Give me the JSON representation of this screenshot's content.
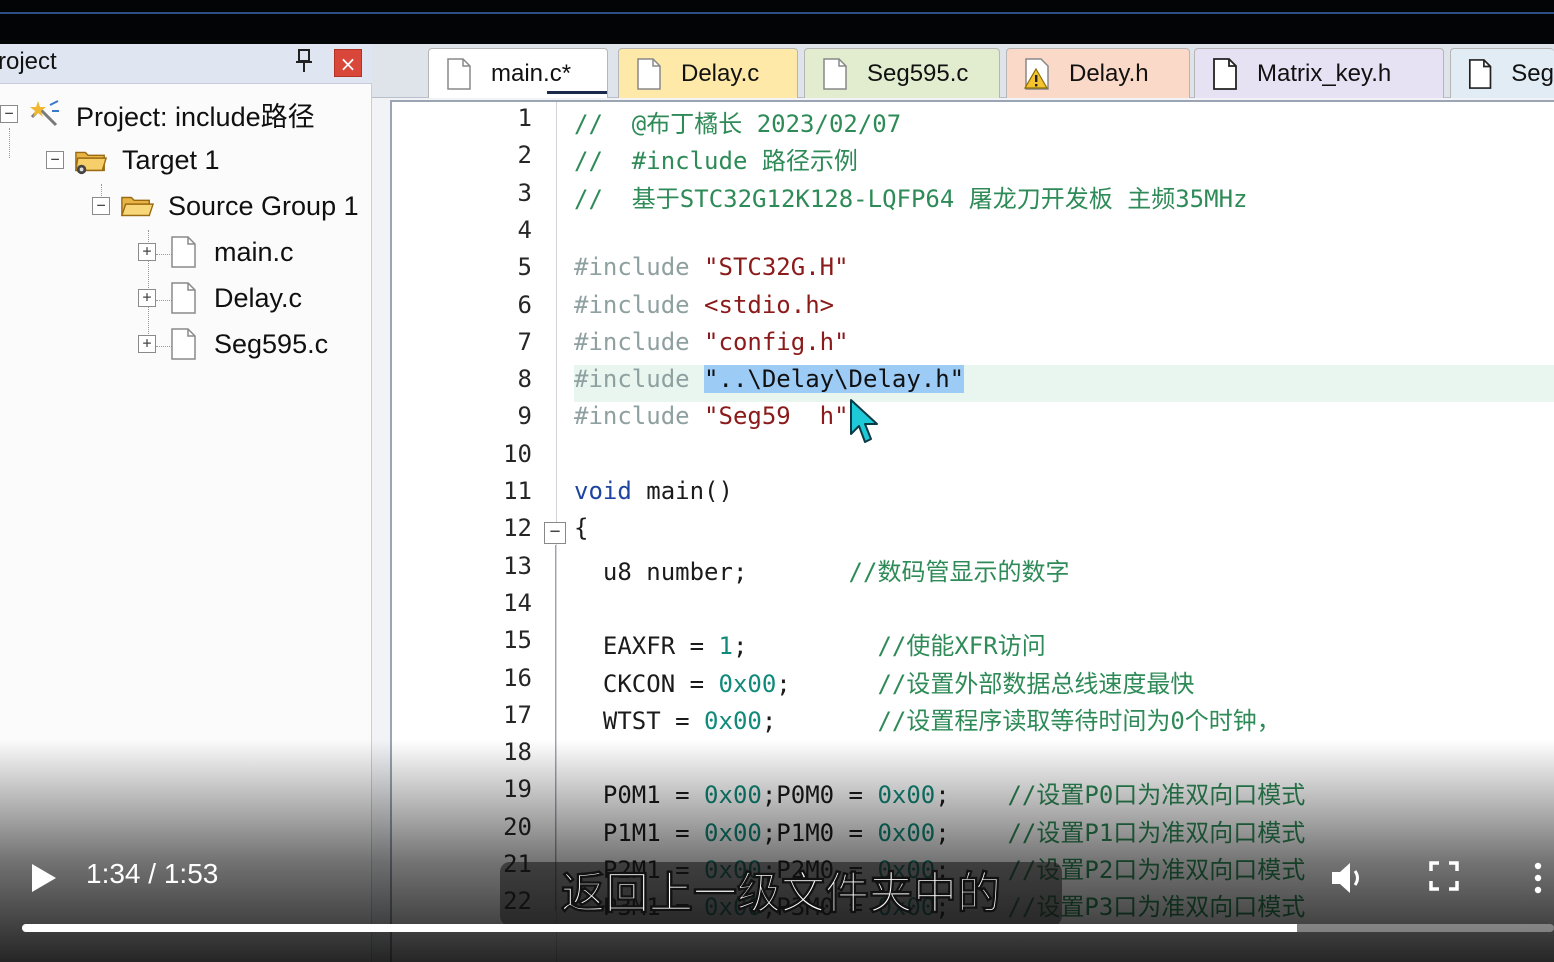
{
  "project_panel": {
    "title": "roject",
    "pin_glyph": "📌",
    "close_glyph": "×",
    "tree": {
      "project_label": "Project: include路径",
      "target_label": "Target 1",
      "group_label": "Source Group 1",
      "files": [
        "main.c",
        "Delay.c",
        "Seg595.c"
      ]
    }
  },
  "editor": {
    "tabs": [
      "main.c*",
      "Delay.c",
      "Seg595.c",
      "Delay.h",
      "Matrix_key.h",
      "Seg"
    ],
    "active_tab": "main.c*",
    "lines": [
      {
        "n": "1",
        "t": [
          [
            "cm",
            "//  @布丁橘长 2023/02/07"
          ]
        ]
      },
      {
        "n": "2",
        "t": [
          [
            "cm",
            "//  #include 路径示例"
          ]
        ]
      },
      {
        "n": "3",
        "t": [
          [
            "cm",
            "//  基于STC32G12K128-LQFP64 屠龙刀开发板 主频35MHz"
          ]
        ]
      },
      {
        "n": "4",
        "t": []
      },
      {
        "n": "5",
        "t": [
          [
            "pp",
            "#include "
          ],
          [
            "st",
            "\"STC32G.H\""
          ]
        ]
      },
      {
        "n": "6",
        "t": [
          [
            "pp",
            "#include "
          ],
          [
            "st",
            "<stdio.h>"
          ]
        ]
      },
      {
        "n": "7",
        "t": [
          [
            "pp",
            "#include "
          ],
          [
            "st",
            "\"config.h\""
          ]
        ]
      },
      {
        "n": "8",
        "t": [
          [
            "pp",
            "#include "
          ],
          [
            "sel",
            "\"..\\Delay\\Delay.h\""
          ]
        ]
      },
      {
        "n": "9",
        "t": [
          [
            "pp",
            "#include "
          ],
          [
            "st",
            "\"Seg59"
          ],
          [
            "st",
            "  h\""
          ]
        ]
      },
      {
        "n": "10",
        "t": []
      },
      {
        "n": "11",
        "t": [
          [
            "kw",
            "void"
          ],
          [
            "",
            " main()"
          ]
        ]
      },
      {
        "n": "12",
        "t": [
          [
            "",
            "{"
          ]
        ]
      },
      {
        "n": "13",
        "t": [
          [
            "",
            "  u8 number;       "
          ],
          [
            "cm",
            "//数码管显示的数字"
          ]
        ]
      },
      {
        "n": "14",
        "t": []
      },
      {
        "n": "15",
        "t": [
          [
            "",
            "  EAXFR = "
          ],
          [
            "nm",
            "1"
          ],
          [
            "",
            ";         "
          ],
          [
            "cm",
            "//使能XFR访问"
          ]
        ]
      },
      {
        "n": "16",
        "t": [
          [
            "",
            "  CKCON = "
          ],
          [
            "nm",
            "0x00"
          ],
          [
            "",
            ";      "
          ],
          [
            "cm",
            "//设置外部数据总线速度最快"
          ]
        ]
      },
      {
        "n": "17",
        "t": [
          [
            "",
            "  WTST = "
          ],
          [
            "nm",
            "0x00"
          ],
          [
            "",
            ";       "
          ],
          [
            "cm",
            "//设置程序读取等待时间为0个时钟，"
          ]
        ]
      },
      {
        "n": "18",
        "t": []
      },
      {
        "n": "19",
        "t": [
          [
            "",
            "  P0M1 = "
          ],
          [
            "nm",
            "0x00"
          ],
          [
            "",
            ";P0M0 = "
          ],
          [
            "nm",
            "0x00"
          ],
          [
            "",
            ";    "
          ],
          [
            "cm",
            "//设置P0口为准双向口模式"
          ]
        ]
      },
      {
        "n": "20",
        "t": [
          [
            "",
            "  P1M1 = "
          ],
          [
            "nm",
            "0x00"
          ],
          [
            "",
            ";P1M0 = "
          ],
          [
            "nm",
            "0x00"
          ],
          [
            "",
            ";    "
          ],
          [
            "cm",
            "//设置P1口为准双向口模式"
          ]
        ]
      },
      {
        "n": "21",
        "t": [
          [
            "",
            "  P2M1 = "
          ],
          [
            "nm",
            "0x00"
          ],
          [
            "",
            ";P2M0 = "
          ],
          [
            "nm",
            "0x00"
          ],
          [
            "",
            ";    "
          ],
          [
            "cm",
            "//设置P2口为准双向口模式"
          ]
        ]
      },
      {
        "n": "22",
        "t": [
          [
            "",
            "  P3M1 = "
          ],
          [
            "nm",
            "0x00"
          ],
          [
            "",
            ";P3M0 = "
          ],
          [
            "nm",
            "0x00"
          ],
          [
            "",
            ";    "
          ],
          [
            "cm",
            "//设置P3口为准双向口模式"
          ]
        ]
      }
    ]
  },
  "video": {
    "subtitle": "返回上一级文件夹中的",
    "current_time": "1:34",
    "separator": "/",
    "duration": "1:53",
    "progress_fraction": 0.832
  },
  "colors": {
    "comment": "#2e8b57",
    "preprocessor": "#8fa0a0",
    "string": "#8b1a1a",
    "keyword": "#1f45a0",
    "number": "#108a7a",
    "selection": "#9ccbf6",
    "current_line": "#e8f6ef"
  },
  "icons": {
    "project": "project-wand-icon",
    "target": "target-folder-icon",
    "group": "folder-open-icon",
    "file": "file-icon",
    "warning": "warning-file-icon",
    "play": "play-icon",
    "volume": "volume-icon",
    "fullscreen": "fullscreen-icon",
    "more": "more-vertical-icon"
  }
}
